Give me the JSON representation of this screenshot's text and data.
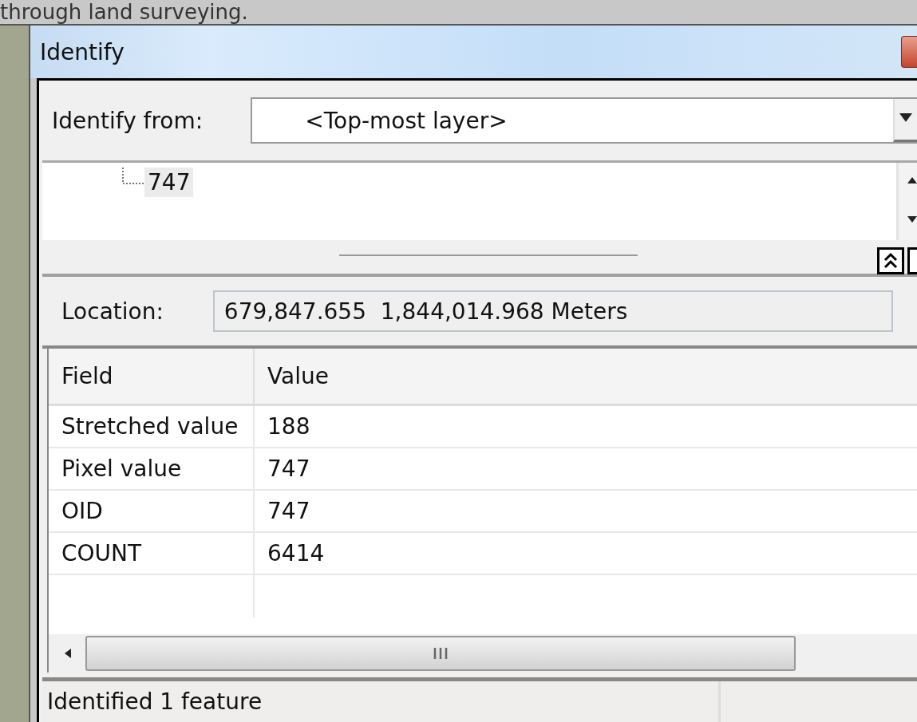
{
  "caption": "through land surveying.",
  "window": {
    "title": "Identify"
  },
  "identify_from": {
    "label": "Identify from:",
    "value": "<Top-most layer>"
  },
  "tree": {
    "items": [
      {
        "label": "747",
        "selected": true
      }
    ]
  },
  "location": {
    "label": "Location:",
    "value": "679,847.655  1,844,014.968 Meters"
  },
  "table": {
    "columns": [
      "Field",
      "Value"
    ],
    "rows": [
      {
        "field": "Stretched value",
        "value": "188"
      },
      {
        "field": "Pixel value",
        "value": "747"
      },
      {
        "field": "OID",
        "value": "747"
      },
      {
        "field": "COUNT",
        "value": "6414"
      }
    ]
  },
  "status_bar": "Identified 1 feature"
}
